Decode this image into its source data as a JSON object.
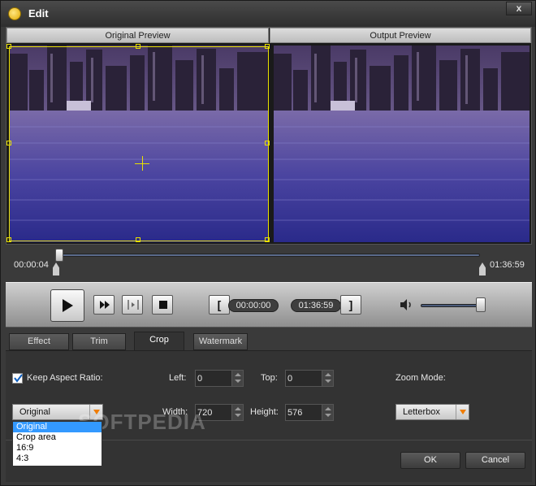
{
  "window": {
    "title": "Edit",
    "close_label": "x"
  },
  "preview": {
    "original_label": "Original Preview",
    "output_label": "Output Preview"
  },
  "timeline": {
    "start_time": "00:00:04",
    "end_time": "01:36:59"
  },
  "controls": {
    "trim_start": "00:00:00",
    "trim_end": "01:36:59",
    "mark_in_label": "[",
    "mark_out_label": "]",
    "volume_level": 0.9
  },
  "tabs": [
    {
      "label": "Effect"
    },
    {
      "label": "Trim"
    },
    {
      "label": "Crop",
      "active": true
    },
    {
      "label": "Watermark"
    }
  ],
  "crop": {
    "keep_aspect_label": "Keep Aspect Ratio:",
    "keep_aspect_checked": true,
    "left_label": "Left:",
    "left_value": "0",
    "top_label": "Top:",
    "top_value": "0",
    "width_label": "Width:",
    "width_value": "720",
    "height_label": "Height:",
    "height_value": "576",
    "zoom_mode_label": "Zoom Mode:",
    "zoom_mode_value": "Letterbox",
    "aspect_value": "Original",
    "aspect_options": [
      "Original",
      "Crop area",
      "16:9",
      "4:3"
    ]
  },
  "watermark_text": "SOFTPEDIA",
  "footer": {
    "ok_label": "OK",
    "cancel_label": "Cancel"
  },
  "colors": {
    "accent": "#e8e000",
    "selection": "#3399ff",
    "dropdown_arrow": "#f07d00"
  }
}
